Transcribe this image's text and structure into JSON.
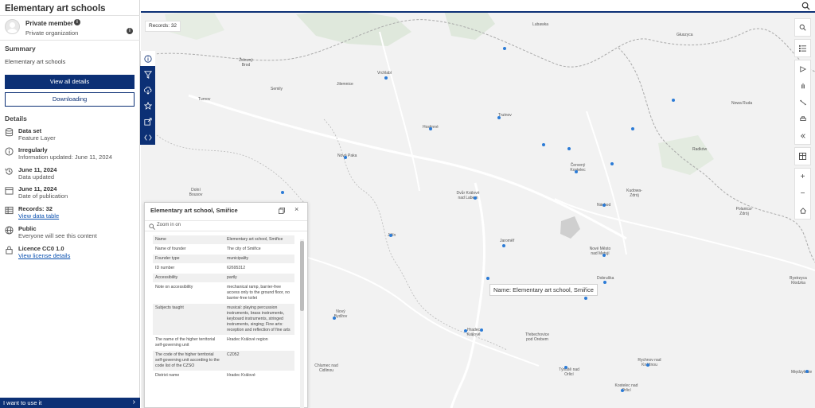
{
  "panel": {
    "title": "Elementary art schools",
    "member_name": "Private member",
    "member_org": "Private organization",
    "summary_heading": "Summary",
    "summary_text": "Elementary art schools",
    "view_all_details": "View all details",
    "downloading": "Downloading",
    "details_heading": "Details",
    "details": {
      "dataset": {
        "title": "Data set",
        "sub": "Feature Layer"
      },
      "update": {
        "title": "Irregularly",
        "sub": "Information updated: June 11, 2024"
      },
      "updated": {
        "title": "June 11, 2024",
        "sub": "Data updated"
      },
      "published": {
        "title": "June 11, 2024",
        "sub": "Date of publication"
      },
      "records": {
        "title": "Records: 32",
        "link": "View data table"
      },
      "public": {
        "title": "Public",
        "sub": "Everyone will see this content"
      },
      "licence": {
        "title": "Licence CC0 1.0",
        "link": "View license details"
      }
    },
    "bottom_cta": "I want to use it"
  },
  "map": {
    "records_badge": "Records: 32",
    "tooltip": "Name: Elementary art school, Smiřice",
    "towns": [
      "Lubawka",
      "Głuszyca",
      "Železný Brod",
      "Vrchlabí",
      "Semily",
      "Jilemnice",
      "Turnov",
      "Trutnov",
      "Hostinné",
      "Nowa Ruda",
      "Radków",
      "Nová Paka",
      "Červený Kostelec",
      "Dvůr Králové nad Labem",
      "Kudowa-Zdrój",
      "Polanica-Zdrój",
      "Jičín",
      "Náchod",
      "Jaroměř",
      "Nové Město nad Metují",
      "Dobruška",
      "Nový Bydžov",
      "Hradec Králové",
      "Třebechovice pod Orebem",
      "Bystrzyca Kłodzka",
      "Chlumec nad Cidlinou",
      "Týniště nad Orlicí",
      "Rychnov nad Kněžnou",
      "Kostelec nad Orlicí",
      "Międzylesie",
      "Dolní Bousov"
    ]
  },
  "popup": {
    "title": "Elementary art school, Smiřice",
    "zoom_to": "Zoom in on",
    "rows": [
      {
        "k": "Name",
        "v": "Elementary art school, Smiřice"
      },
      {
        "k": "Name of founder",
        "v": "The city of Smiřice"
      },
      {
        "k": "Founder type",
        "v": "municipality"
      },
      {
        "k": "ID number",
        "v": "62695312"
      },
      {
        "k": "Accessibility",
        "v": "partly"
      },
      {
        "k": "Note on accessibility",
        "v": "mechanical ramp, barrier-free access only to the ground floor, no barrier-free toilet"
      },
      {
        "k": "Subjects taught",
        "v": "musical: playing percussion instruments, brass instruments, keyboard instruments, stringed instruments, singing; Fine arts: reception and reflection of fine arts"
      },
      {
        "k": "The name of the higher territorial self-governing unit",
        "v": "Hradec Králové region"
      },
      {
        "k": "The code of the higher territorial self-governing unit according to the code list of the CZSO",
        "v": "CZ052"
      },
      {
        "k": "District name",
        "v": "Hradec Králové"
      }
    ]
  },
  "colors": {
    "primary": "#0c3075",
    "point": "#2b7bd6",
    "map_bg": "#f2f2f2"
  }
}
